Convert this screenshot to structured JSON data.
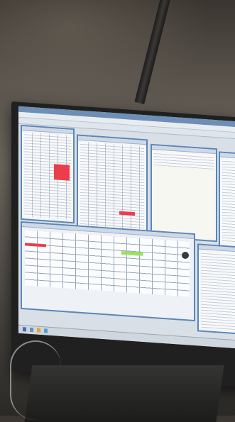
{
  "scene": {
    "description_colors": {
      "screen_bg": "#d9dfe6",
      "panel_border": "#5b86b8",
      "alert_red": "#ec3d4c",
      "highlight_green": "#9be25a"
    }
  }
}
